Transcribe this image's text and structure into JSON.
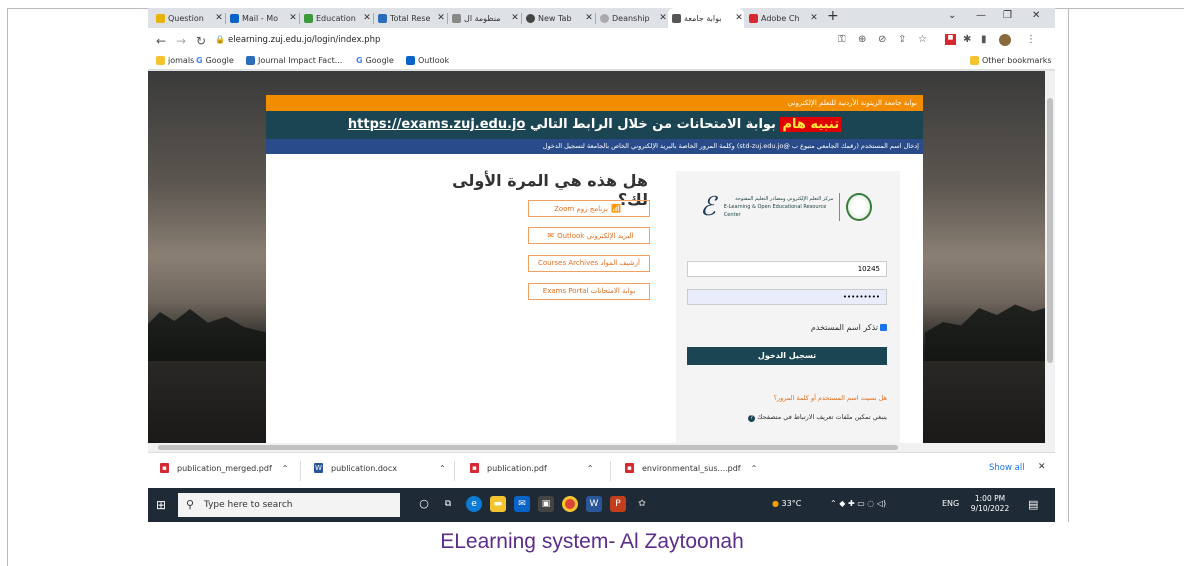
{
  "browser": {
    "tabs": [
      {
        "label": "Question",
        "color": "#e8b400"
      },
      {
        "label": "Mail - Mo",
        "color": "#0a64c8"
      },
      {
        "label": "Education",
        "color": "#3c9a3c"
      },
      {
        "label": "Total Rese",
        "color": "#2a6ebb"
      },
      {
        "label": "منظومة ال",
        "color": "#888888"
      },
      {
        "label": "New Tab",
        "color": "#444444"
      },
      {
        "label": "Deanship",
        "color": "#aaaaaa"
      },
      {
        "label": "بوابة جامعة",
        "color": "#555555"
      },
      {
        "label": "Adobe Ch",
        "color": "#d7282f"
      }
    ],
    "new_tab": "+",
    "url": "elearning.zuj.edu.jo/login/index.php",
    "bookmarks": [
      {
        "label": "jomals",
        "color": "#f4c430"
      },
      {
        "label": "Google",
        "color": "#4285f4"
      },
      {
        "label": "Journal Impact Fact...",
        "color": "#2a6ebb"
      },
      {
        "label": "Google",
        "color": "#4285f4"
      },
      {
        "label": "Outlook",
        "color": "#0a64c8"
      }
    ],
    "other_bookmarks": "Other bookmarks"
  },
  "page": {
    "orange_bar": "بوابة جامعة الزيتونة الأردنية للتعلم الإلكتروني",
    "banner_warning": "تنبيه هام",
    "banner_text": "بوابة الامتحانات من خلال الرابط التالي",
    "banner_link": "https://exams.zuj.edu.jo",
    "blue_bar": "إدخال اسم المستخدم (رقمك الجامعي متبوع ب @std-zuj.edu.jo) وكلمة المرور الخاصة بالبريد الإلكتروني الخاص بالجامعة لتسجيل الدخول",
    "first_time": "هل هذه هي المرة الأولى لك؟",
    "quick_links": [
      {
        "label": "برنامج زوم Zoom",
        "icon": "chart-icon",
        "glyph": "📶"
      },
      {
        "label": "البريد الإلكتروني Outlook",
        "icon": "envelope-icon",
        "glyph": "✉"
      },
      {
        "label": "أرشيف المواد Courses Archives",
        "icon": "archive-icon",
        "glyph": "▤"
      },
      {
        "label": "بوابة الامتحانات Exams Portal",
        "icon": "pencil-icon",
        "glyph": "✎"
      }
    ],
    "logo_text": "مركز التعلم الإلكتروني ومصادر التعليم المفتوحة",
    "logo_text_en": "E-Learning & Open Educational Resource Center",
    "username_value": "10245",
    "password_value": "•••••••••",
    "remember_label": "تذكر اسم المستخدم",
    "login_button": "تسجيل الدخول",
    "forgot_link": "هل نسيت اسم المستخدم أو كلمة المرور؟",
    "cookies_note": "ينبغي تمكين ملفات تعريف الارتباط في متصفحك"
  },
  "downloads": {
    "items": [
      {
        "name": "publication_merged.pdf",
        "type": "pdf",
        "color": "#d7282f"
      },
      {
        "name": "publication.docx",
        "type": "docx",
        "color": "#2b579a"
      },
      {
        "name": "publication.pdf",
        "type": "pdf",
        "color": "#d7282f"
      },
      {
        "name": "environmental_sus....pdf",
        "type": "pdf",
        "color": "#d7282f"
      }
    ],
    "show_all": "Show all"
  },
  "taskbar": {
    "search_placeholder": "Type here to search",
    "weather": "33°C",
    "language": "ENG",
    "time": "1:00 PM",
    "date": "9/10/2022"
  },
  "caption": "ELearning system- Al Zaytoonah"
}
